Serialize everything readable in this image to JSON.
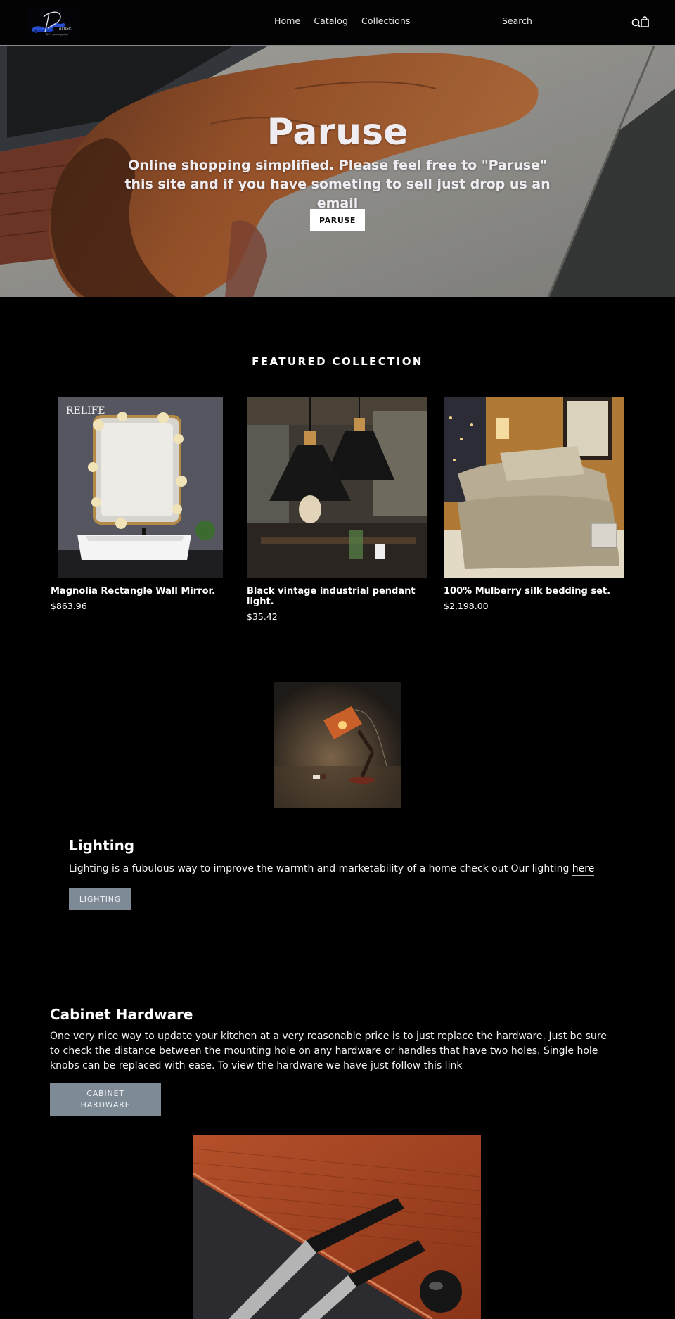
{
  "header": {
    "logo_alt": "Paruse logo",
    "nav": [
      {
        "label": "Home"
      },
      {
        "label": "Catalog"
      },
      {
        "label": "Collections"
      }
    ],
    "search_label": "Search",
    "icons": [
      "search-icon",
      "cart-icon"
    ]
  },
  "hero": {
    "title": "Paruse",
    "subtitle": "Online shopping simplified. Please feel free to \"Paruse\" this site and if you have someting to sell just drop us an email",
    "button_label": "PARUSE"
  },
  "featured": {
    "title": "FEATURED COLLECTION",
    "products": [
      {
        "name": "Magnolia Rectangle Wall Mirror.",
        "price": "$863.96",
        "image_label": "RELIFE"
      },
      {
        "name": "Black vintage industrial pendant light.",
        "price": "$35.42"
      },
      {
        "name": "100% Mulberry silk bedding set.",
        "price": "$2,198.00"
      }
    ]
  },
  "lighting": {
    "title": "Lighting",
    "text": "Lighting is a fubulous way to improve the warmth and marketability of a home check out Our lighting ",
    "link_label": "here",
    "button_label": "LIGHTING"
  },
  "cabinet": {
    "title": "Cabinet Hardware",
    "text": "One very nice way to update your kitchen at a very reasonable price is to just replace the hardware. Just be sure to check the distance between the mounting hole on any hardware or handles that have two holes. Single hole knobs can be replaced with ease. To view the hardware we have just follow this link",
    "button_label_line1": "CABINET",
    "button_label_line2": "HARDWARE"
  },
  "colors": {
    "background": "#000000",
    "button_grey": "#7e8b97",
    "hero_button": "#ffffff"
  }
}
